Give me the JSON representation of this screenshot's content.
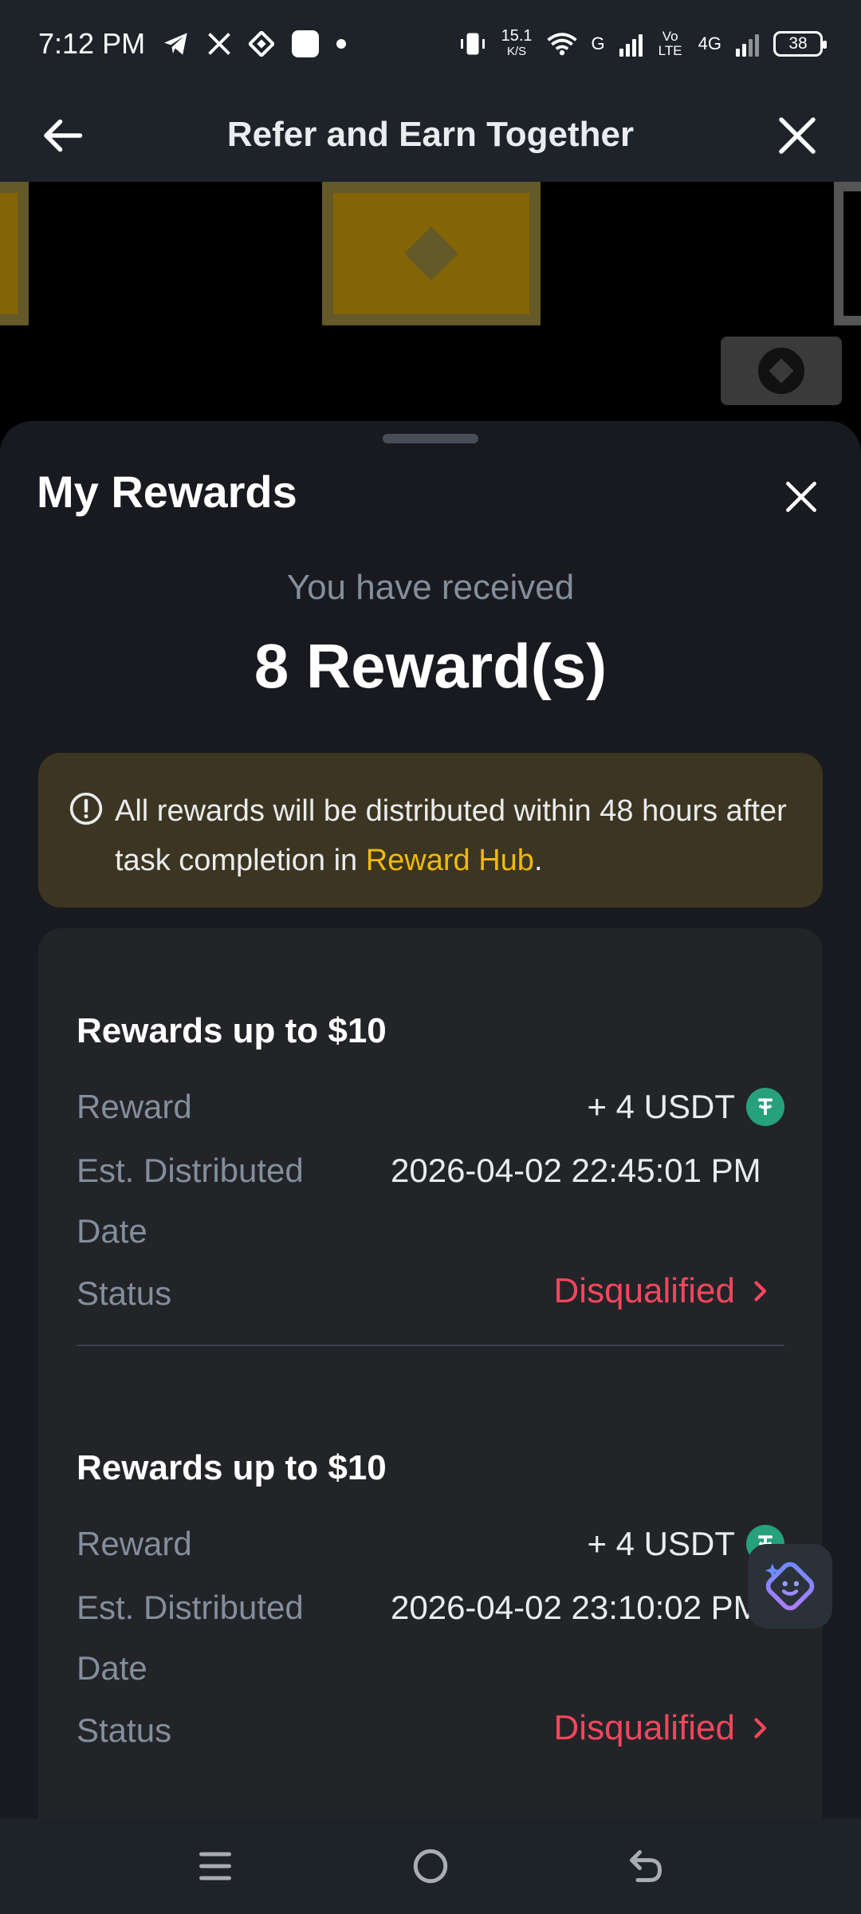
{
  "status_bar": {
    "time": "7:12 PM",
    "speed_value": "15.1",
    "speed_unit": "K/S",
    "network_1": "G",
    "network_2": "Vo LTE",
    "network_3": "4G",
    "battery": "38"
  },
  "header": {
    "title": "Refer and Earn Together"
  },
  "sheet": {
    "title": "My Rewards",
    "received_label": "You have received",
    "reward_count": "8 Reward(s)",
    "notice": {
      "text_before": "All rewards will be distributed within 48 hours after task completion in ",
      "link": "Reward Hub",
      "text_after": "."
    },
    "labels": {
      "reward": "Reward",
      "date_line1": "Est. Distributed",
      "date_line2": "Date",
      "status": "Status"
    },
    "rewards": [
      {
        "title": "Rewards up to $10",
        "amount": "+ 4 USDT",
        "date": "2026-04-02 22:45:01 PM",
        "status": "Disqualified"
      },
      {
        "title": "Rewards up to $10",
        "amount": "+ 4 USDT",
        "date": "2026-04-02 23:10:02 PM",
        "status": "Disqualified"
      }
    ]
  },
  "colors": {
    "accent": "#f0b90b",
    "status_negative": "#f6465d",
    "usdt": "#26a17b"
  }
}
